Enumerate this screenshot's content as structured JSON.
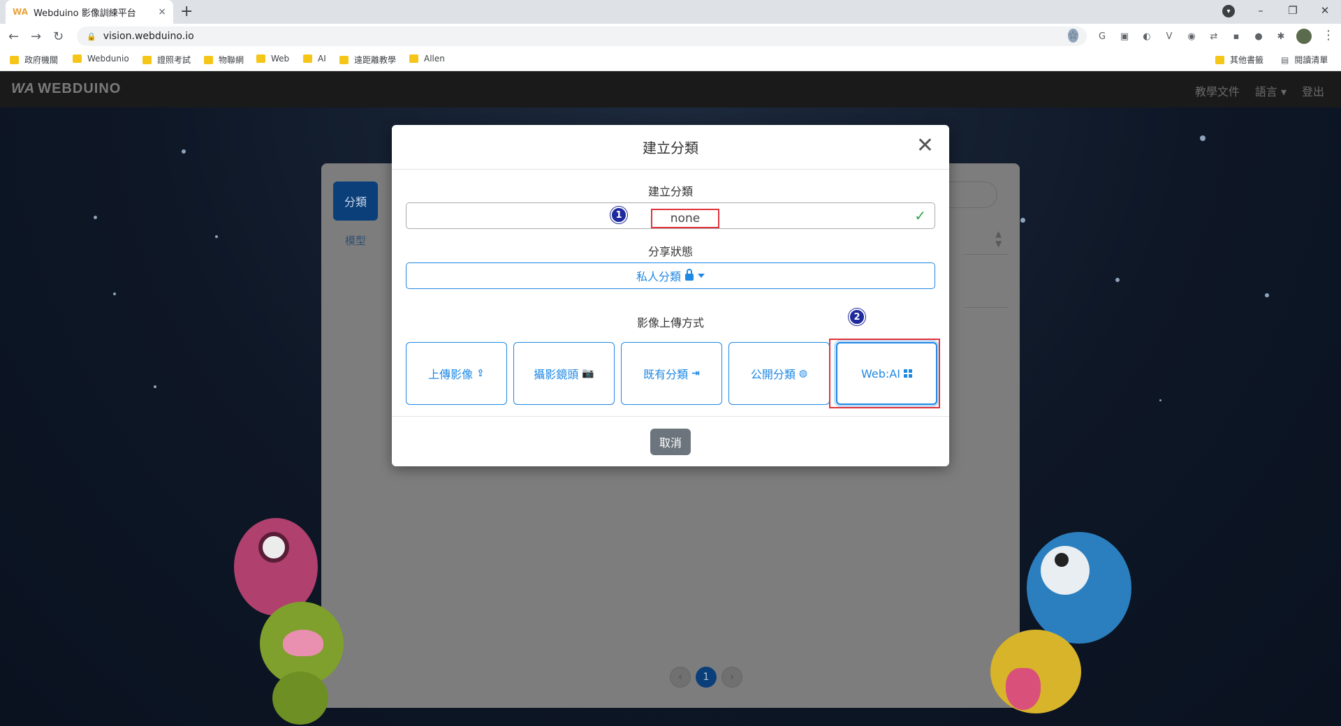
{
  "browser": {
    "tab_title": "Webduino 影像訓練平台",
    "tab_favicon": "WA",
    "tab_close": "×",
    "new_tab": "+",
    "url": "vision.webduino.io",
    "window_controls": [
      "–",
      "❐",
      "✕"
    ],
    "bookmarks": [
      "政府機關",
      "Webdunio",
      "證照考試",
      "物聯網",
      "Web",
      "AI",
      "遠距離教學",
      "Allen"
    ],
    "bookmarks_right": [
      "其他書籤",
      "閱讀清單"
    ]
  },
  "site": {
    "logo": "WEBDUINO",
    "logo_mark": "WA",
    "nav": [
      "教學文件",
      "語言 ▾",
      "登出"
    ]
  },
  "background": {
    "side_tab_category": "分類",
    "side_tab_model": "模型",
    "pager_prev": "‹",
    "pager_current": "1",
    "pager_next": "›"
  },
  "modal": {
    "title": "建立分類",
    "close": "✕",
    "name_label": "建立分類",
    "name_value": "none",
    "name_valid": "✓",
    "share_label": "分享狀態",
    "share_value": "私人分類",
    "upload_label": "影像上傳方式",
    "upload_options": [
      {
        "label": "上傳影像",
        "icon": "upload-icon"
      },
      {
        "label": "攝影鏡頭",
        "icon": "camera-icon"
      },
      {
        "label": "既有分類",
        "icon": "import-icon"
      },
      {
        "label": "公開分類",
        "icon": "globe-icon"
      },
      {
        "label": "Web:AI",
        "icon": "qrcode-icon"
      }
    ],
    "cancel": "取消",
    "annotation_1": "1",
    "annotation_2": "2"
  },
  "colors": {
    "primary": "#1e88e5",
    "annotation": "#e0323a",
    "valid": "#28a745",
    "cancel": "#6c757d"
  }
}
